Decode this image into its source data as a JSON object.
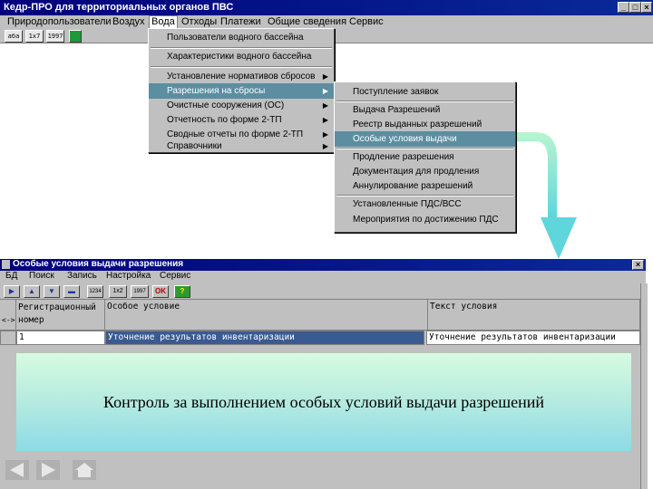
{
  "main_window": {
    "title": "Кедр-ПРО для территориальных органов ПВС",
    "menu": [
      "Природопользователи",
      "Воздух",
      "Вода",
      "Отходы",
      "Платежи",
      "Общие сведения",
      "Сервис"
    ],
    "toolbar_labels": [
      "аба",
      "1х7",
      "1997"
    ]
  },
  "water_menu": {
    "items": [
      {
        "label": "Пользователи водного бассейна",
        "submenu": false
      },
      {
        "label": "Характеристики водного бассейна",
        "submenu": false
      },
      {
        "label": "Установление нормативов сбросов",
        "submenu": true
      },
      {
        "label": "Разрешения на сбросы",
        "submenu": true
      },
      {
        "label": "Очистные сооружения (ОС)",
        "submenu": true
      },
      {
        "label": "Отчетность по форме 2-ТП",
        "submenu": true
      },
      {
        "label": "Сводные отчеты по форме 2-ТП",
        "submenu": true
      },
      {
        "label": "Справочники",
        "submenu": true
      }
    ]
  },
  "permits_submenu": {
    "items": [
      "Поступление заявок",
      "Выдача Разрешений",
      "Реестр выданных разрешений",
      "Особые условия выдачи",
      "Продление разрешения",
      "Документация для продления",
      "Аннулирование разрешений",
      "Установленные ПДС/ВСС",
      "Мероприятия по достижению ПДС"
    ]
  },
  "child_window": {
    "title": "Особые условия выдачи разрешения",
    "menu": [
      "БД",
      "Поиск",
      "Запись",
      "Настройка",
      "Сервис"
    ],
    "toolbar_labels": [
      "1234",
      "1х2",
      "1997",
      "OK",
      "?"
    ],
    "columns": [
      "Регистрационный номер",
      "Особое условие",
      "Текст условия"
    ],
    "row_marker": "<->",
    "rows": [
      {
        "reg_number": "1",
        "condition": "Уточнение результатов инвентаризации",
        "text": "Уточнение результатов инвентаризации"
      }
    ]
  },
  "caption": "Контроль за выполнением особых условий выдачи разрешений",
  "colors": {
    "titlebar": "#00007a",
    "highlight": "#5b8ea0",
    "arrow": "#7fe3e0",
    "caption_gradient_top": "#d6fbe1",
    "caption_gradient_bottom": "#8ddbe6"
  }
}
